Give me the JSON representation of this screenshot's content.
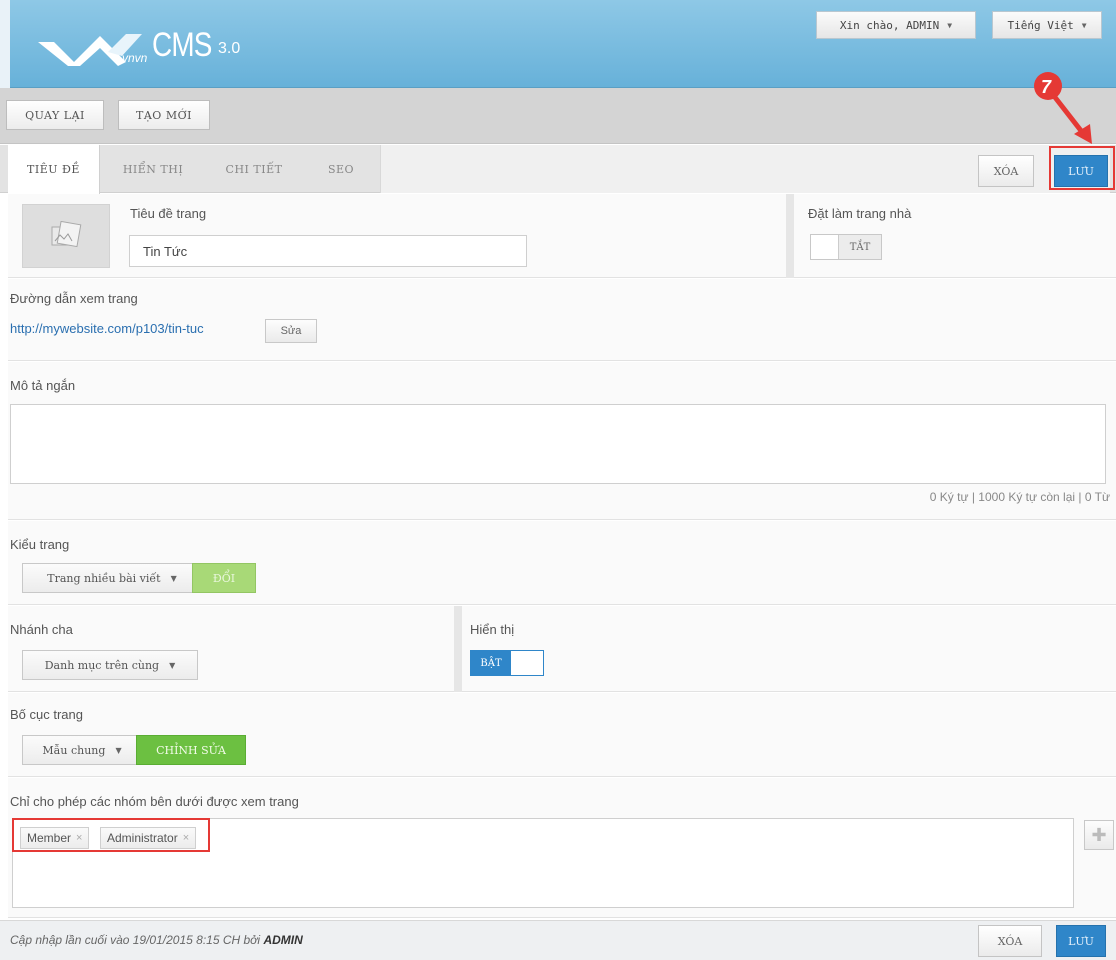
{
  "header": {
    "logo_text": "CMS",
    "logo_version": "3.0",
    "logo_sub": "vnvn",
    "user_menu": "Xin chào, ADMIN",
    "language_menu": "Tiếng Việt"
  },
  "toolbar": {
    "back_label": "QUAY LẠI",
    "new_label": "TẠO MỚI"
  },
  "tabs": [
    {
      "label": "TIÊU ĐỀ"
    },
    {
      "label": "HIỂN THỊ"
    },
    {
      "label": "CHI TIẾT"
    },
    {
      "label": "SEO"
    }
  ],
  "actions": {
    "delete_label": "XÓA",
    "save_label": "LƯU",
    "step_number": "7"
  },
  "title_section": {
    "label": "Tiêu đề trang",
    "value": "Tin Tức",
    "homepage_label": "Đặt làm trang nhà",
    "homepage_toggle": "TẮT"
  },
  "url_section": {
    "label": "Đường dẫn xem trang",
    "url": "http://mywebsite.com/p103/tin-tuc",
    "edit_label": "Sửa"
  },
  "description_section": {
    "label": "Mô tả ngắn",
    "value": "",
    "counter": "0 Ký tự | 1000 Ký tự còn lại | 0 Từ"
  },
  "page_type_section": {
    "label": "Kiểu trang",
    "selected": "Trang nhiều bài viết",
    "change_label": "ĐỔI"
  },
  "parent_section": {
    "label": "Nhánh cha",
    "selected": "Danh mục trên cùng",
    "display_label": "Hiển thị",
    "display_toggle": "BẬT"
  },
  "layout_section": {
    "label": "Bố cục trang",
    "selected": "Mẫu chung",
    "edit_label": "CHỈNH SỬA"
  },
  "permissions_section": {
    "label": "Chỉ cho phép các nhóm bên dưới được xem trang",
    "groups": [
      "Member",
      "Administrator"
    ]
  },
  "footer": {
    "updated_prefix": "Cập nhập lần cuối vào 19/01/2015 8:15 CH bởi",
    "updated_by": "ADMIN",
    "delete_label": "XÓA",
    "save_label": "LƯU"
  },
  "colors": {
    "header": "#67b1d9",
    "save_button": "#2f86c9",
    "toggle_on": "#2f86c9",
    "change_button": "#9ed46a",
    "edit_button": "#6cc041",
    "highlight": "#e53935"
  }
}
